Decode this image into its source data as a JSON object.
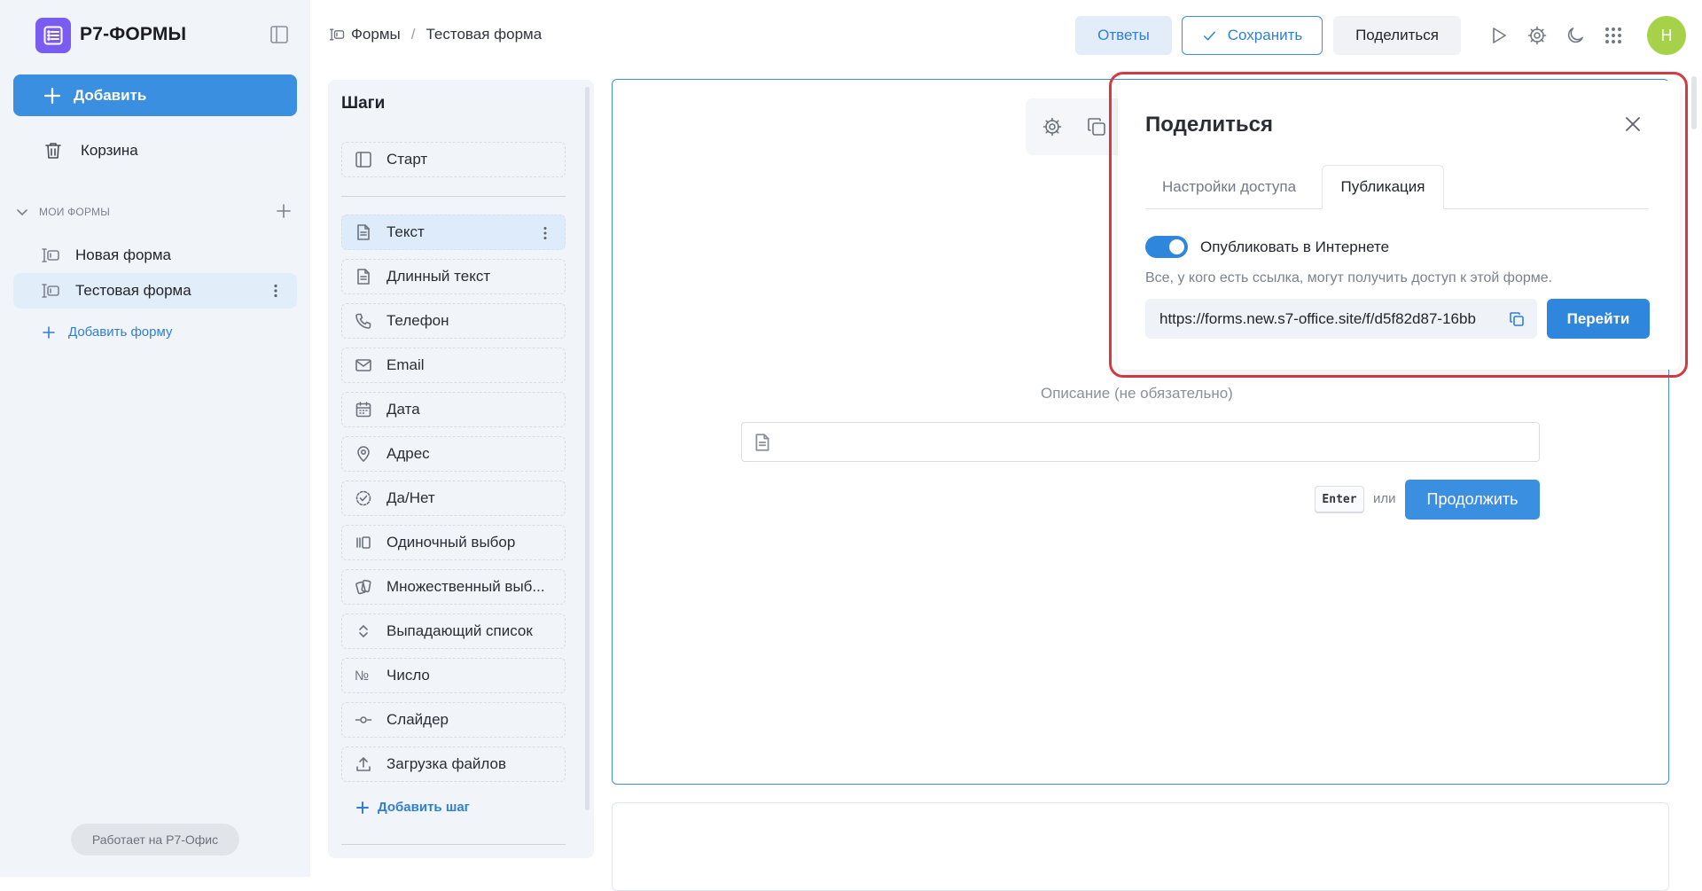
{
  "app": {
    "title": "Р7-ФОРМЫ"
  },
  "sidebar": {
    "add_label": "Добавить",
    "trash_label": "Корзина",
    "section_title": "Мои формы",
    "forms": [
      {
        "label": "Новая форма",
        "active": false
      },
      {
        "label": "Тестовая форма",
        "active": true
      }
    ],
    "add_form_label": "Добавить форму",
    "powered_by": "Работает на Р7-Офис"
  },
  "header": {
    "breadcrumb": [
      "Формы",
      "Тестовая форма"
    ],
    "breadcrumb_separator": "/",
    "answers_label": "Ответы",
    "save_label": "Сохранить",
    "share_label": "Поделиться",
    "avatar_letter": "Н",
    "icons": [
      "play-icon",
      "gear-icon",
      "moon-icon",
      "apps-grid-icon"
    ]
  },
  "steps": {
    "title": "Шаги",
    "items": [
      {
        "label": "Старт",
        "icon": "panel-icon"
      },
      {
        "label": "Текст",
        "icon": "document-icon",
        "active": true
      },
      {
        "label": "Длинный текст",
        "icon": "document-icon"
      },
      {
        "label": "Телефон",
        "icon": "phone-icon"
      },
      {
        "label": "Email",
        "icon": "mail-icon"
      },
      {
        "label": "Дата",
        "icon": "calendar-icon"
      },
      {
        "label": "Адрес",
        "icon": "map-pin-icon"
      },
      {
        "label": "Да/Нет",
        "icon": "check-circle-icon"
      },
      {
        "label": "Одиночный выбор",
        "icon": "single-choice-icon"
      },
      {
        "label": "Множественный выб...",
        "icon": "multi-choice-icon"
      },
      {
        "label": "Выпадающий список",
        "icon": "chevron-updown-icon"
      },
      {
        "label": "Число",
        "icon": "number-sign-icon"
      },
      {
        "label": "Слайдер",
        "icon": "slider-icon"
      },
      {
        "label": "Загрузка файлов",
        "icon": "upload-icon"
      }
    ],
    "number_glyph": "№",
    "add_step_label": "Добавить шаг"
  },
  "editor": {
    "description_label": "Описание (не обязательно)",
    "enter_key": "Enter",
    "or_text": "или",
    "continue_label": "Продолжить"
  },
  "share_popup": {
    "title": "Поделиться",
    "tabs": [
      {
        "label": "Настройки доступа",
        "active": false
      },
      {
        "label": "Публикация",
        "active": true
      }
    ],
    "publish_toggle_label": "Опубликовать в Интернете",
    "publish_toggle_on": true,
    "description": "Все, у кого есть ссылка, могут получить доступ к этой форме.",
    "url": "https://forms.new.s7-office.site/f/d5f82d87-16bb",
    "go_label": "Перейти"
  },
  "colors": {
    "accent": "#3b8fe0",
    "brand_logo": "#7b5cf0",
    "avatar": "#a6d24a",
    "highlight": "#d63a45",
    "sidebar_bg": "#f1f4f9"
  }
}
